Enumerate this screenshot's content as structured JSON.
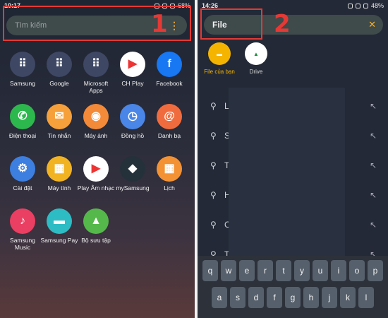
{
  "left": {
    "status": {
      "time": "10:17",
      "battery": "68%"
    },
    "search": {
      "placeholder": "Tìm kiếm",
      "menu_glyph": "⋮"
    },
    "step": "1",
    "apps": [
      {
        "label": "Samsung",
        "color": "#3e4763",
        "glyph": "⠿"
      },
      {
        "label": "Google",
        "color": "#3e4763",
        "glyph": "⠿"
      },
      {
        "label": "Microsoft Apps",
        "color": "#3e4763",
        "glyph": "⠿"
      },
      {
        "label": "CH Play",
        "color": "#ffffff",
        "glyph": "▶"
      },
      {
        "label": "Facebook",
        "color": "#1877f2",
        "glyph": "f"
      },
      {
        "label": "Điện thoại",
        "color": "#2db84d",
        "glyph": "✆"
      },
      {
        "label": "Tin nhắn",
        "color": "#f6a03c",
        "glyph": "✉"
      },
      {
        "label": "Máy ảnh",
        "color": "#f28a3a",
        "glyph": "◉"
      },
      {
        "label": "Đồng hồ",
        "color": "#4a86e8",
        "glyph": "◷"
      },
      {
        "label": "Danh bạ",
        "color": "#f06c3f",
        "glyph": "@"
      },
      {
        "label": "Cài đặt",
        "color": "#3d7fe0",
        "glyph": "⚙"
      },
      {
        "label": "Máy tính",
        "color": "#f2b323",
        "glyph": "▦"
      },
      {
        "label": "Play Âm nhạc",
        "color": "#ffffff",
        "glyph": "▶"
      },
      {
        "label": "mySamsung",
        "color": "#24313b",
        "glyph": "◆"
      },
      {
        "label": "Lịch",
        "color": "#f39234",
        "glyph": "▦"
      },
      {
        "label": "Samsung Music",
        "color": "#ea3f62",
        "glyph": "♪"
      },
      {
        "label": "Samsung Pay",
        "color": "#2dbcc4",
        "glyph": "▬"
      },
      {
        "label": "Bộ sưu tập",
        "color": "#55b84a",
        "glyph": "▲"
      }
    ]
  },
  "right": {
    "status": {
      "time": "14:26",
      "battery": "48%"
    },
    "search": {
      "value": "File",
      "clear_glyph": "✕"
    },
    "step": "2",
    "quick_results": [
      {
        "label": "File của bạn",
        "color": "#f5b400",
        "label_color": "#f5b400",
        "glyph": "▬"
      },
      {
        "label": "Drive",
        "color": "#ffffff",
        "label_color": "#dddddd",
        "glyph": "▲"
      }
    ],
    "suggestions": [
      {
        "text": "L"
      },
      {
        "text": "S"
      },
      {
        "text": "T"
      },
      {
        "text": "H"
      },
      {
        "text": "C"
      },
      {
        "text": "T"
      }
    ],
    "keyboard": {
      "row1": [
        "q",
        "w",
        "e",
        "r",
        "t",
        "y",
        "u",
        "i",
        "o",
        "p"
      ],
      "row2": [
        "a",
        "s",
        "d",
        "f",
        "g",
        "h",
        "j",
        "k",
        "l"
      ]
    }
  }
}
